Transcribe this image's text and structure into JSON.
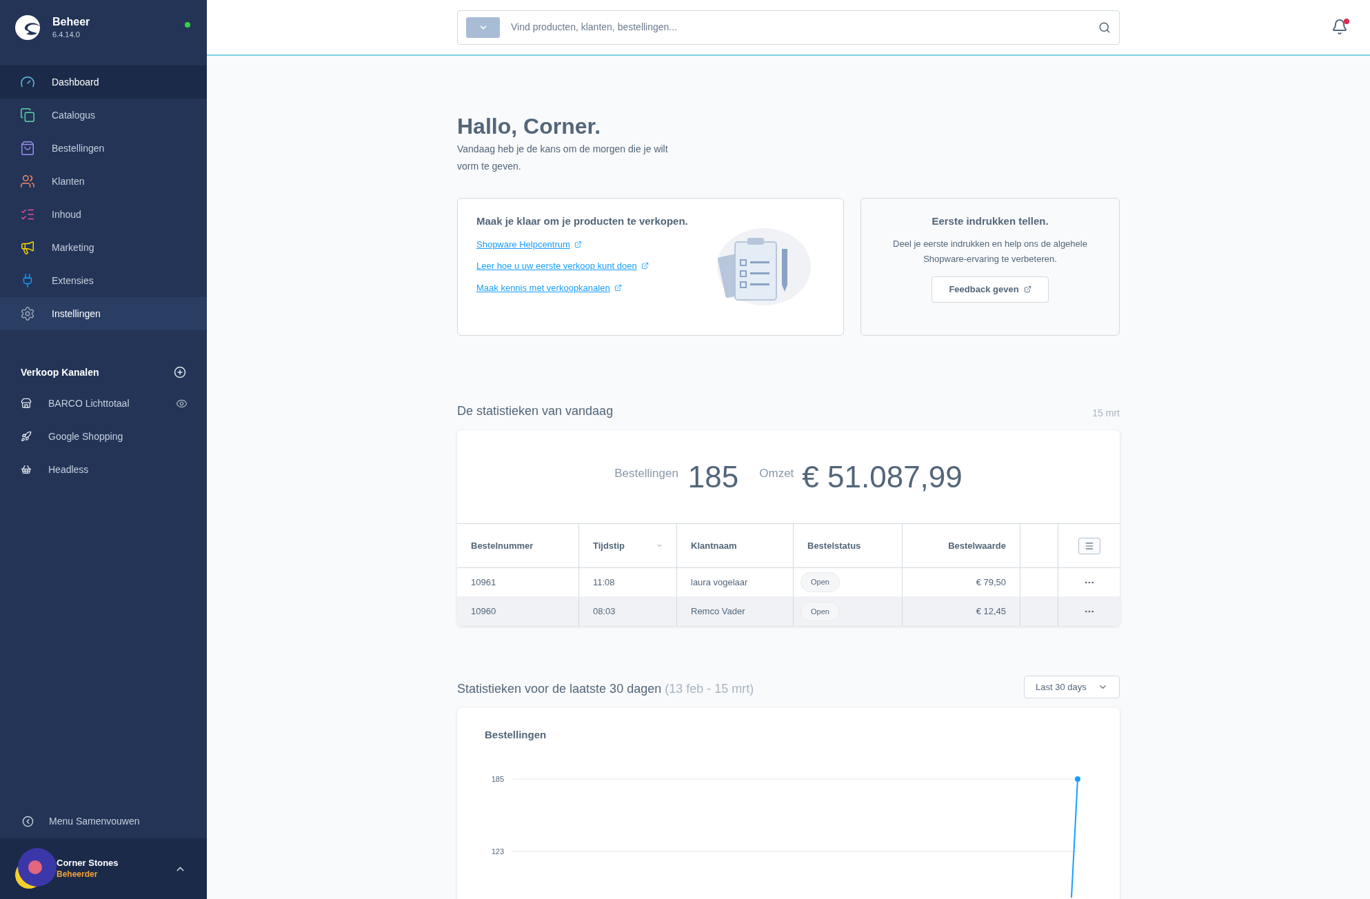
{
  "brand": {
    "title": "Beheer",
    "version": "6.4.14.0",
    "online": true
  },
  "nav": [
    {
      "label": "Dashboard",
      "color": "#5fc6f5",
      "selected": true,
      "hover": false
    },
    {
      "label": "Catalogus",
      "color": "#57d9a3",
      "selected": false,
      "hover": false
    },
    {
      "label": "Bestellingen",
      "color": "#9d8ef0",
      "selected": false,
      "hover": false
    },
    {
      "label": "Klanten",
      "color": "#f88962",
      "selected": false,
      "hover": false
    },
    {
      "label": "Inhoud",
      "color": "#ea4ca8",
      "selected": false,
      "hover": false
    },
    {
      "label": "Marketing",
      "color": "#ffd700",
      "selected": false,
      "hover": false
    },
    {
      "label": "Extensies",
      "color": "#189eff",
      "selected": false,
      "hover": false
    },
    {
      "label": "Instellingen",
      "color": "#9aa8b5",
      "selected": false,
      "hover": true
    }
  ],
  "sales_channels": {
    "title": "Verkoop Kanalen",
    "items": [
      {
        "label": "BARCO Lichttotaal",
        "visible_toggle": true
      },
      {
        "label": "Google Shopping",
        "visible_toggle": false
      },
      {
        "label": "Headless",
        "visible_toggle": false
      }
    ]
  },
  "collapse": "Menu Samenvouwen",
  "user": {
    "name": "Corner Stones",
    "role": "Beheerder"
  },
  "search": {
    "placeholder": "Vind producten, klanten, bestellingen..."
  },
  "notifications": {
    "unread": true
  },
  "greeting": {
    "title": "Hallo, Corner.",
    "subtitle": "Vandaag heb je de kans om de morgen die je wilt vorm te geven."
  },
  "intro_card": {
    "title": "Maak je klaar om je producten te verkopen.",
    "links": [
      "Shopware Helpcentrum",
      "Leer hoe u uw eerste verkoop kunt doen",
      "Maak kennis met verkoopkanalen"
    ]
  },
  "feedback_card": {
    "title": "Eerste indrukken tellen.",
    "text": "Deel je eerste indrukken en help ons de algehele Shopware-ervaring te verbeteren.",
    "button": "Feedback geven"
  },
  "today": {
    "title": "De statistieken van vandaag",
    "date": "15 mrt",
    "orders_label": "Bestellingen",
    "orders": "185",
    "revenue_label": "Omzet",
    "revenue": "€ 51.087,99",
    "table": {
      "columns": [
        {
          "label": "Bestelnummer",
          "sortable": false
        },
        {
          "label": "Tijdstip",
          "sortable": true
        },
        {
          "label": "Klantnaam",
          "sortable": false
        },
        {
          "label": "Bestelstatus",
          "sortable": false
        },
        {
          "label": "Bestelwaarde",
          "sortable": false
        }
      ],
      "rows": [
        {
          "cells": [
            "10961",
            "11:08",
            "laura vogelaar",
            "Open",
            "€ 79,50"
          ],
          "hover": false
        },
        {
          "cells": [
            "10960",
            "08:03",
            "Remco Vader",
            "Open",
            "€ 12,45"
          ],
          "hover": true
        }
      ]
    }
  },
  "period": {
    "title": "Statistieken voor de laatste 30 dagen",
    "range": "(13 feb - 15 mrt)",
    "select": "Last 30 days",
    "chart": {
      "title": "Bestellingen",
      "y_labels": [
        "185",
        "123"
      ]
    }
  }
}
